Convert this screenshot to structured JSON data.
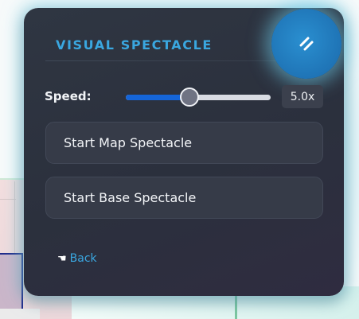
{
  "panel": {
    "title": "VISUAL SPECTACLE",
    "collapse_icon": "double-slash-icon"
  },
  "speed": {
    "label": "Speed:",
    "value_text": "5.0x",
    "fraction": 0.44
  },
  "buttons": {
    "map_label": "Start Map Spectacle",
    "base_label": "Start Base Spectacle"
  },
  "back": {
    "icon": "pointing-hand-icon",
    "icon_glyph": "☚",
    "label": "Back"
  },
  "colors": {
    "accent": "#3aa7e0",
    "slider_fill": "#1565d8",
    "panel_bg": "#2d323f",
    "collapse_button": "#1f74b6"
  }
}
